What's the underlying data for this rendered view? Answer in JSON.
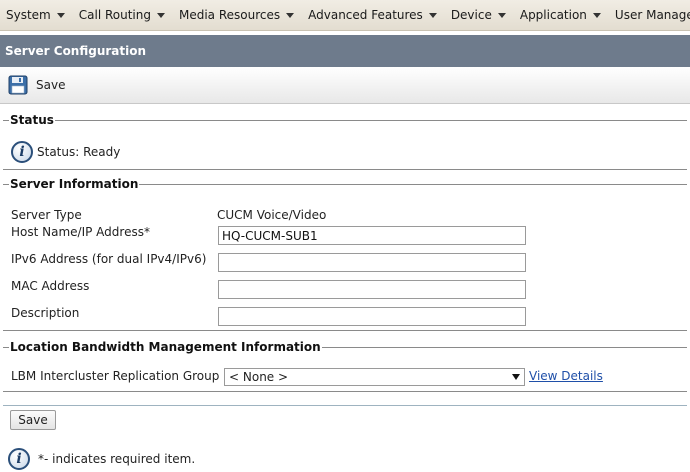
{
  "menu": {
    "items": [
      {
        "label": "System"
      },
      {
        "label": "Call Routing"
      },
      {
        "label": "Media Resources"
      },
      {
        "label": "Advanced Features"
      },
      {
        "label": "Device"
      },
      {
        "label": "Application"
      },
      {
        "label": "User Management"
      }
    ]
  },
  "page_title": "Server Configuration",
  "toolbar": {
    "save_label": "Save",
    "save_icon": "floppy-disk-icon"
  },
  "status": {
    "legend": "Status",
    "icon": "info-icon",
    "icon_glyph": "i",
    "text": "Status: Ready"
  },
  "server_info": {
    "legend": "Server Information",
    "server_type_label": "Server Type",
    "server_type_value": "CUCM Voice/Video",
    "host_label": "Host Name/IP Address*",
    "host_value": "HQ-CUCM-SUB1",
    "ipv6_label": "IPv6 Address (for dual IPv4/IPv6)",
    "ipv6_value": "",
    "mac_label": "MAC Address",
    "mac_value": "",
    "description_label": "Description",
    "description_value": ""
  },
  "lbm": {
    "legend": "Location Bandwidth Management Information",
    "group_label": "LBM Intercluster Replication Group",
    "group_selected": "< None >",
    "view_details": "View Details"
  },
  "footer": {
    "save_label": "Save",
    "note_icon_glyph": "i",
    "note": "*- indicates required item."
  },
  "colors": {
    "title_bar": "#6e7b8c",
    "menu_bar": "#e9e4d8",
    "link": "#1f4fa8"
  }
}
